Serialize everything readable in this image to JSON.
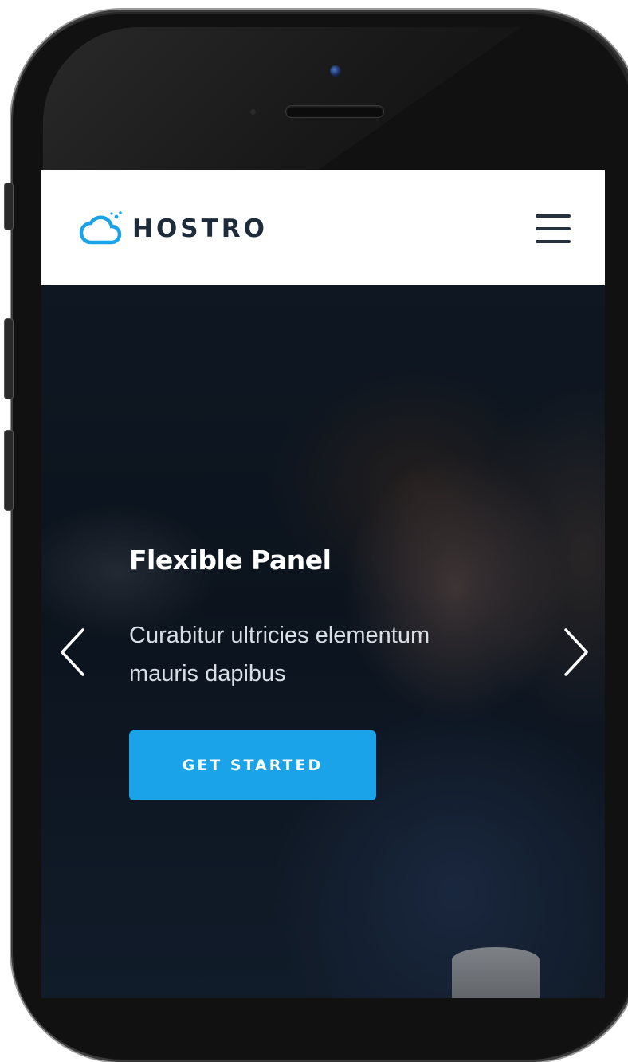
{
  "brand": {
    "name": "HOSTRO",
    "logo_icon": "cloud-icon",
    "accent_color": "#1aa3e8",
    "text_color": "#1e2b3a"
  },
  "nav": {
    "menu_icon": "hamburger-menu-icon"
  },
  "hero": {
    "title": "Flexible Panel",
    "subtitle": "Curabitur ultricies elementum mauris dapibus",
    "cta_label": "GET STARTED",
    "prev_icon": "chevron-left-icon",
    "next_icon": "chevron-right-icon"
  }
}
